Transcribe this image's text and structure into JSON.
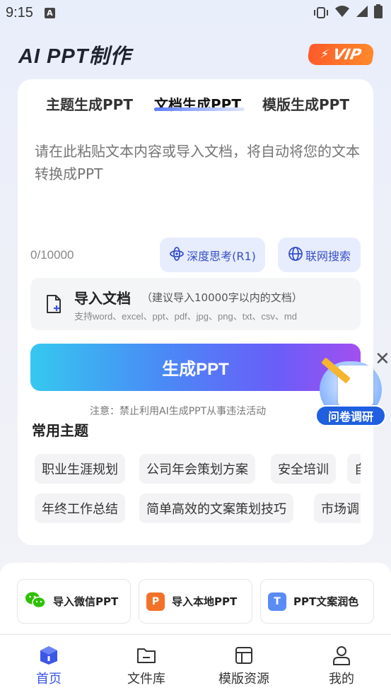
{
  "status_bar": {
    "time": "9:15",
    "notif_icon": "A"
  },
  "header": {
    "title": "AI PPT制作",
    "vip_label": "VIP"
  },
  "tabs": [
    {
      "label": "主题生成PPT",
      "active": false
    },
    {
      "label": "文档生成PPT",
      "active": true
    },
    {
      "label": "模版生成PPT",
      "active": false
    }
  ],
  "editor": {
    "placeholder": "请在此粘贴文本内容或导入文档，将自动将您的文本转换成PPT",
    "char_count": "0/10000"
  },
  "options": {
    "deep_think": "深度思考(R1)",
    "web_search": "联网搜索"
  },
  "import": {
    "title": "导入文档",
    "hint": "（建议导入10000字以内的文档）",
    "types": "支持word、excel、ppt、pdf、jpg、png、txt、csv、md"
  },
  "generate_button": "生成PPT",
  "notice": "注意：禁止利用AI生成PPT从事违法活动",
  "common_topics": {
    "title": "常用主题",
    "chips": [
      "职业生涯规划",
      "公司年会策划方案",
      "安全培训",
      "自",
      "年终工作总结",
      "简单高效的文案策划技巧",
      "市场调"
    ]
  },
  "survey": {
    "label": "问卷调研",
    "close": "✕"
  },
  "tools": [
    {
      "label": "导入微信PPT",
      "icon": "wechat-icon",
      "color": "#2dc100"
    },
    {
      "label": "导入本地PPT",
      "icon": "ppt-file-icon",
      "color": "#f2722a",
      "glyph": "P"
    },
    {
      "label": "PPT文案润色",
      "icon": "text-icon",
      "color": "#5b8cf5",
      "glyph": "T"
    }
  ],
  "nav": [
    {
      "label": "首页",
      "active": true
    },
    {
      "label": "文件库",
      "active": false
    },
    {
      "label": "模版资源",
      "active": false
    },
    {
      "label": "我的",
      "active": false
    }
  ],
  "colors": {
    "accent": "#3a57e8",
    "vip": "#ff6a2a",
    "pill_bg": "#e8edfd"
  }
}
